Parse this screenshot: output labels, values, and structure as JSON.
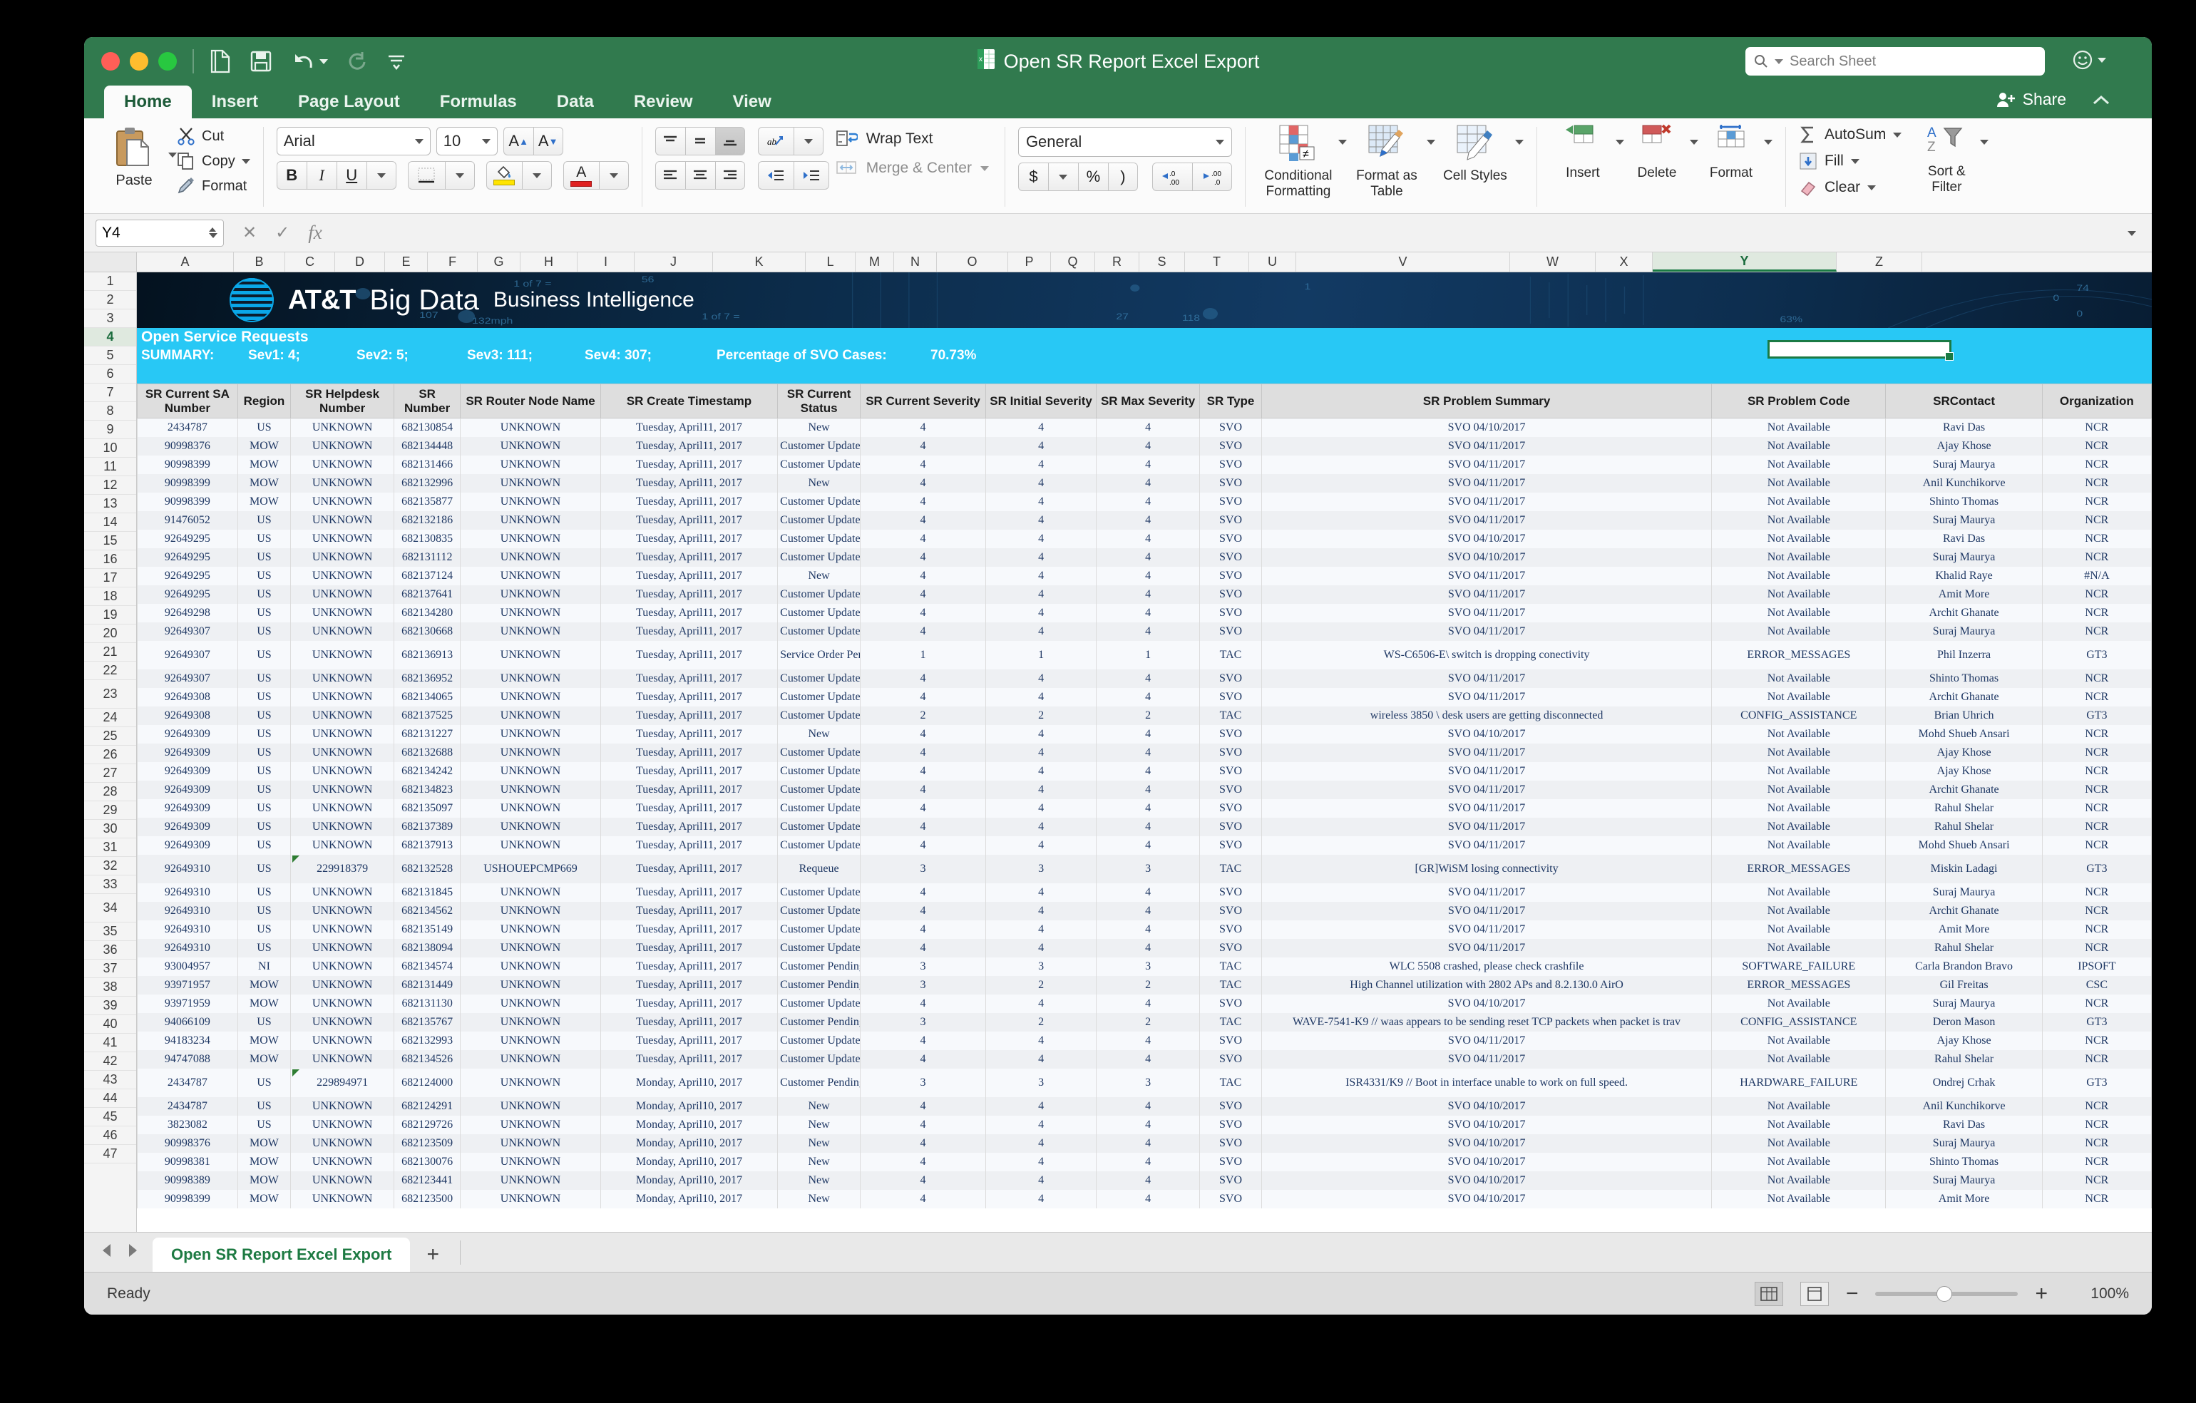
{
  "window": {
    "title": "Open SR Report Excel Export",
    "search_placeholder": "Search Sheet",
    "quick_access": [
      "new-icon",
      "save-icon",
      "undo-icon",
      "redo-icon",
      "customize-icon"
    ]
  },
  "ribbon": {
    "tabs": [
      {
        "label": "Home",
        "active": true
      },
      {
        "label": "Insert",
        "active": false
      },
      {
        "label": "Page Layout",
        "active": false
      },
      {
        "label": "Formulas",
        "active": false
      },
      {
        "label": "Data",
        "active": false
      },
      {
        "label": "Review",
        "active": false
      },
      {
        "label": "View",
        "active": false
      }
    ],
    "share_label": "Share",
    "clipboard": {
      "paste_label": "Paste",
      "cut_label": "Cut",
      "copy_label": "Copy",
      "format_label": "Format"
    },
    "font": {
      "family": "Arial",
      "size": "10",
      "bold": "B",
      "italic": "I",
      "underline": "U",
      "grow_label": "A",
      "shrink_label": "A"
    },
    "alignment": {
      "wrap_text_label": "Wrap Text",
      "merge_center_label": "Merge & Center"
    },
    "number": {
      "format": "General",
      "currency": "$",
      "percent": "%",
      "comma": ")",
      "increase_decimal": ".00",
      "decrease_decimal": ".00"
    },
    "styles": {
      "conditional_formatting": "Conditional Formatting",
      "format_as_table": "Format as Table",
      "cell_styles": "Cell Styles"
    },
    "cells": {
      "insert": "Insert",
      "delete": "Delete",
      "format": "Format"
    },
    "editing": {
      "autosum": "AutoSum",
      "fill": "Fill",
      "clear": "Clear",
      "sort_filter": "Sort & Filter"
    }
  },
  "formula_bar": {
    "name_box": "Y4",
    "formula": ""
  },
  "grid": {
    "columns": [
      "A",
      "B",
      "C",
      "D",
      "E",
      "F",
      "G",
      "H",
      "I",
      "J",
      "K",
      "L",
      "M",
      "N",
      "O",
      "P",
      "Q",
      "R",
      "S",
      "T",
      "U",
      "V",
      "W",
      "X",
      "Y",
      "Z"
    ],
    "selected_column": "Y",
    "selected_cell": "Y4",
    "row_numbers": [
      1,
      2,
      3,
      4,
      5,
      6,
      7,
      8,
      9,
      10,
      11,
      12,
      13,
      14,
      15,
      16,
      17,
      18,
      19,
      20,
      21,
      22,
      23,
      24,
      25,
      26,
      27,
      28,
      29,
      30,
      31,
      32,
      33,
      34,
      35,
      36,
      37,
      38,
      39,
      40,
      41,
      42,
      43,
      44,
      45,
      46,
      47
    ],
    "selected_row": 4
  },
  "banner": {
    "brand": "AT&T",
    "product": "Big Data",
    "subtitle": "Business Intelligence"
  },
  "summary": {
    "title": "Open Service Requests",
    "label": "SUMMARY:",
    "sev1": "Sev1: 4;",
    "sev2": "Sev2: 5;",
    "sev3": "Sev3: 111;",
    "sev4": "Sev4: 307;",
    "pct_label": "Percentage of SVO Cases:",
    "pct_value": "70.73%"
  },
  "table": {
    "headers": [
      "SR Current SA Number",
      "Region",
      "SR Helpdesk Number",
      "SR Number",
      "SR Router Node Name",
      "SR Create Timestamp",
      "SR Current Status",
      "SR Current Severity",
      "SR Initial Severity",
      "SR Max Severity",
      "SR Type",
      "SR Problem Summary",
      "SR Problem Code",
      "SRContact",
      "Organization"
    ],
    "rows": [
      [
        "2434787",
        "US",
        "UNKNOWN",
        "682130854",
        "UNKNOWN",
        "Tuesday, April11, 2017",
        "New",
        "4",
        "4",
        "4",
        "SVO",
        "SVO 04/10/2017",
        "Not Available",
        "Ravi Das",
        "NCR"
      ],
      [
        "90998376",
        "MOW",
        "UNKNOWN",
        "682134448",
        "UNKNOWN",
        "Tuesday, April11, 2017",
        "Customer Updated",
        "4",
        "4",
        "4",
        "SVO",
        "SVO 04/11/2017",
        "Not Available",
        "Ajay Khose",
        "NCR"
      ],
      [
        "90998399",
        "MOW",
        "UNKNOWN",
        "682131466",
        "UNKNOWN",
        "Tuesday, April11, 2017",
        "Customer Updated",
        "4",
        "4",
        "4",
        "SVO",
        "SVO 04/11/2017",
        "Not Available",
        "Suraj Maurya",
        "NCR"
      ],
      [
        "90998399",
        "MOW",
        "UNKNOWN",
        "682132996",
        "UNKNOWN",
        "Tuesday, April11, 2017",
        "New",
        "4",
        "4",
        "4",
        "SVO",
        "SVO 04/11/2017",
        "Not Available",
        "Anil Kunchikorve",
        "NCR"
      ],
      [
        "90998399",
        "MOW",
        "UNKNOWN",
        "682135877",
        "UNKNOWN",
        "Tuesday, April11, 2017",
        "Customer Updated",
        "4",
        "4",
        "4",
        "SVO",
        "SVO 04/11/2017",
        "Not Available",
        "Shinto Thomas",
        "NCR"
      ],
      [
        "91476052",
        "US",
        "UNKNOWN",
        "682132186",
        "UNKNOWN",
        "Tuesday, April11, 2017",
        "Customer Updated",
        "4",
        "4",
        "4",
        "SVO",
        "SVO 04/11/2017",
        "Not Available",
        "Suraj Maurya",
        "NCR"
      ],
      [
        "92649295",
        "US",
        "UNKNOWN",
        "682130835",
        "UNKNOWN",
        "Tuesday, April11, 2017",
        "Customer Updated",
        "4",
        "4",
        "4",
        "SVO",
        "SVO 04/10/2017",
        "Not Available",
        "Ravi Das",
        "NCR"
      ],
      [
        "92649295",
        "US",
        "UNKNOWN",
        "682131112",
        "UNKNOWN",
        "Tuesday, April11, 2017",
        "Customer Updated",
        "4",
        "4",
        "4",
        "SVO",
        "SVO 04/10/2017",
        "Not Available",
        "Suraj Maurya",
        "NCR"
      ],
      [
        "92649295",
        "US",
        "UNKNOWN",
        "682137124",
        "UNKNOWN",
        "Tuesday, April11, 2017",
        "New",
        "4",
        "4",
        "4",
        "SVO",
        "SVO 04/11/2017",
        "Not Available",
        "Khalid Raye",
        "#N/A"
      ],
      [
        "92649295",
        "US",
        "UNKNOWN",
        "682137641",
        "UNKNOWN",
        "Tuesday, April11, 2017",
        "Customer Updated",
        "4",
        "4",
        "4",
        "SVO",
        "SVO 04/11/2017",
        "Not Available",
        "Amit More",
        "NCR"
      ],
      [
        "92649298",
        "US",
        "UNKNOWN",
        "682134280",
        "UNKNOWN",
        "Tuesday, April11, 2017",
        "Customer Updated",
        "4",
        "4",
        "4",
        "SVO",
        "SVO 04/11/2017",
        "Not Available",
        "Archit Ghanate",
        "NCR"
      ],
      [
        "92649307",
        "US",
        "UNKNOWN",
        "682130668",
        "UNKNOWN",
        "Tuesday, April11, 2017",
        "Customer Updated",
        "4",
        "4",
        "4",
        "SVO",
        "SVO 04/11/2017",
        "Not Available",
        "Suraj Maurya",
        "NCR"
      ],
      [
        "92649307",
        "US",
        "UNKNOWN",
        "682136913",
        "UNKNOWN",
        "Tuesday, April11, 2017",
        "Service Order Pending",
        "1",
        "1",
        "1",
        "TAC",
        "WS-C6506-E\\ switch is dropping conectivity",
        "ERROR_MESSAGES",
        "Phil Inzerra",
        "GT3"
      ],
      [
        "92649307",
        "US",
        "UNKNOWN",
        "682136952",
        "UNKNOWN",
        "Tuesday, April11, 2017",
        "Customer Updated",
        "4",
        "4",
        "4",
        "SVO",
        "SVO 04/11/2017",
        "Not Available",
        "Shinto Thomas",
        "NCR"
      ],
      [
        "92649308",
        "US",
        "UNKNOWN",
        "682134065",
        "UNKNOWN",
        "Tuesday, April11, 2017",
        "Customer Updated",
        "4",
        "4",
        "4",
        "SVO",
        "SVO 04/11/2017",
        "Not Available",
        "Archit Ghanate",
        "NCR"
      ],
      [
        "92649308",
        "US",
        "UNKNOWN",
        "682137525",
        "UNKNOWN",
        "Tuesday, April11, 2017",
        "Customer Updated",
        "2",
        "2",
        "2",
        "TAC",
        "wireless 3850 \\ desk users are getting disconnected",
        "CONFIG_ASSISTANCE",
        "Brian Uhrich",
        "GT3"
      ],
      [
        "92649309",
        "US",
        "UNKNOWN",
        "682131227",
        "UNKNOWN",
        "Tuesday, April11, 2017",
        "New",
        "4",
        "4",
        "4",
        "SVO",
        "SVO 04/10/2017",
        "Not Available",
        "Mohd Shueb Ansari",
        "NCR"
      ],
      [
        "92649309",
        "US",
        "UNKNOWN",
        "682132688",
        "UNKNOWN",
        "Tuesday, April11, 2017",
        "Customer Updated",
        "4",
        "4",
        "4",
        "SVO",
        "SVO 04/11/2017",
        "Not Available",
        "Ajay Khose",
        "NCR"
      ],
      [
        "92649309",
        "US",
        "UNKNOWN",
        "682134242",
        "UNKNOWN",
        "Tuesday, April11, 2017",
        "Customer Updated",
        "4",
        "4",
        "4",
        "SVO",
        "SVO 04/11/2017",
        "Not Available",
        "Ajay Khose",
        "NCR"
      ],
      [
        "92649309",
        "US",
        "UNKNOWN",
        "682134823",
        "UNKNOWN",
        "Tuesday, April11, 2017",
        "Customer Updated",
        "4",
        "4",
        "4",
        "SVO",
        "SVO 04/11/2017",
        "Not Available",
        "Archit Ghanate",
        "NCR"
      ],
      [
        "92649309",
        "US",
        "UNKNOWN",
        "682135097",
        "UNKNOWN",
        "Tuesday, April11, 2017",
        "Customer Updated",
        "4",
        "4",
        "4",
        "SVO",
        "SVO 04/11/2017",
        "Not Available",
        "Rahul Shelar",
        "NCR"
      ],
      [
        "92649309",
        "US",
        "UNKNOWN",
        "682137389",
        "UNKNOWN",
        "Tuesday, April11, 2017",
        "Customer Updated",
        "4",
        "4",
        "4",
        "SVO",
        "SVO 04/11/2017",
        "Not Available",
        "Rahul Shelar",
        "NCR"
      ],
      [
        "92649309",
        "US",
        "UNKNOWN",
        "682137913",
        "UNKNOWN",
        "Tuesday, April11, 2017",
        "Customer Updated",
        "4",
        "4",
        "4",
        "SVO",
        "SVO 04/11/2017",
        "Not Available",
        "Mohd Shueb Ansari",
        "NCR"
      ],
      [
        "92649310",
        "US",
        "229918379",
        "682132528",
        "USHOUEPCMP669",
        "Tuesday, April11, 2017",
        "Requeue",
        "3",
        "3",
        "3",
        "TAC",
        "[GR]WiSM losing connectivity",
        "ERROR_MESSAGES",
        "Miskin Ladagi",
        "GT3"
      ],
      [
        "92649310",
        "US",
        "UNKNOWN",
        "682131845",
        "UNKNOWN",
        "Tuesday, April11, 2017",
        "Customer Updated",
        "4",
        "4",
        "4",
        "SVO",
        "SVO 04/11/2017",
        "Not Available",
        "Suraj Maurya",
        "NCR"
      ],
      [
        "92649310",
        "US",
        "UNKNOWN",
        "682134562",
        "UNKNOWN",
        "Tuesday, April11, 2017",
        "Customer Updated",
        "4",
        "4",
        "4",
        "SVO",
        "SVO 04/11/2017",
        "Not Available",
        "Archit Ghanate",
        "NCR"
      ],
      [
        "92649310",
        "US",
        "UNKNOWN",
        "682135149",
        "UNKNOWN",
        "Tuesday, April11, 2017",
        "Customer Updated",
        "4",
        "4",
        "4",
        "SVO",
        "SVO 04/11/2017",
        "Not Available",
        "Amit More",
        "NCR"
      ],
      [
        "92649310",
        "US",
        "UNKNOWN",
        "682138094",
        "UNKNOWN",
        "Tuesday, April11, 2017",
        "Customer Updated",
        "4",
        "4",
        "4",
        "SVO",
        "SVO 04/11/2017",
        "Not Available",
        "Rahul Shelar",
        "NCR"
      ],
      [
        "93004957",
        "NI",
        "UNKNOWN",
        "682134574",
        "UNKNOWN",
        "Tuesday, April11, 2017",
        "Customer Pending",
        "3",
        "3",
        "3",
        "TAC",
        "WLC 5508 crashed, please check crashfile",
        "SOFTWARE_FAILURE",
        "Carla Brandon Bravo",
        "IPSOFT"
      ],
      [
        "93971957",
        "MOW",
        "UNKNOWN",
        "682131449",
        "UNKNOWN",
        "Tuesday, April11, 2017",
        "Customer Pending",
        "3",
        "2",
        "2",
        "TAC",
        "High Channel utilization with 2802 APs and 8.2.130.0 AirO",
        "ERROR_MESSAGES",
        "Gil Freitas",
        "CSC"
      ],
      [
        "93971959",
        "MOW",
        "UNKNOWN",
        "682131130",
        "UNKNOWN",
        "Tuesday, April11, 2017",
        "Customer Updated",
        "4",
        "4",
        "4",
        "SVO",
        "SVO 04/10/2017",
        "Not Available",
        "Suraj Maurya",
        "NCR"
      ],
      [
        "94066109",
        "US",
        "UNKNOWN",
        "682135767",
        "UNKNOWN",
        "Tuesday, April11, 2017",
        "Customer Pending",
        "3",
        "2",
        "2",
        "TAC",
        "WAVE-7541-K9 // waas appears to be sending reset TCP packets when packet is trav",
        "CONFIG_ASSISTANCE",
        "Deron Mason",
        "GT3"
      ],
      [
        "94183234",
        "MOW",
        "UNKNOWN",
        "682132993",
        "UNKNOWN",
        "Tuesday, April11, 2017",
        "Customer Updated",
        "4",
        "4",
        "4",
        "SVO",
        "SVO 04/11/2017",
        "Not Available",
        "Ajay Khose",
        "NCR"
      ],
      [
        "94747088",
        "MOW",
        "UNKNOWN",
        "682134526",
        "UNKNOWN",
        "Tuesday, April11, 2017",
        "Customer Updated",
        "4",
        "4",
        "4",
        "SVO",
        "SVO 04/11/2017",
        "Not Available",
        "Rahul Shelar",
        "NCR"
      ],
      [
        "2434787",
        "US",
        "229894971",
        "682124000",
        "UNKNOWN",
        "Monday, April10, 2017",
        "Customer Pending",
        "3",
        "3",
        "3",
        "TAC",
        "ISR4331/K9 // Boot in interface unable to work on full speed.",
        "HARDWARE_FAILURE",
        "Ondrej Crhak",
        "GT3"
      ],
      [
        "2434787",
        "US",
        "UNKNOWN",
        "682124291",
        "UNKNOWN",
        "Monday, April10, 2017",
        "New",
        "4",
        "4",
        "4",
        "SVO",
        "SVO 04/10/2017",
        "Not Available",
        "Anil Kunchikorve",
        "NCR"
      ],
      [
        "3823082",
        "US",
        "UNKNOWN",
        "682129726",
        "UNKNOWN",
        "Monday, April10, 2017",
        "New",
        "4",
        "4",
        "4",
        "SVO",
        "SVO 04/10/2017",
        "Not Available",
        "Ravi Das",
        "NCR"
      ],
      [
        "90998376",
        "MOW",
        "UNKNOWN",
        "682123509",
        "UNKNOWN",
        "Monday, April10, 2017",
        "New",
        "4",
        "4",
        "4",
        "SVO",
        "SVO 04/10/2017",
        "Not Available",
        "Suraj Maurya",
        "NCR"
      ],
      [
        "90998381",
        "MOW",
        "UNKNOWN",
        "682130076",
        "UNKNOWN",
        "Monday, April10, 2017",
        "New",
        "4",
        "4",
        "4",
        "SVO",
        "SVO 04/10/2017",
        "Not Available",
        "Shinto Thomas",
        "NCR"
      ],
      [
        "90998389",
        "MOW",
        "UNKNOWN",
        "682123441",
        "UNKNOWN",
        "Monday, April10, 2017",
        "New",
        "4",
        "4",
        "4",
        "SVO",
        "SVO 04/10/2017",
        "Not Available",
        "Suraj Maurya",
        "NCR"
      ],
      [
        "90998399",
        "MOW",
        "UNKNOWN",
        "682123500",
        "UNKNOWN",
        "Monday, April10, 2017",
        "New",
        "4",
        "4",
        "4",
        "SVO",
        "SVO 04/10/2017",
        "Not Available",
        "Amit More",
        "NCR"
      ]
    ],
    "comment_rows": [
      12,
      23,
      34
    ]
  },
  "sheet_tabs": {
    "tabs": [
      {
        "label": "Open SR Report Excel Export",
        "active": true
      }
    ],
    "add_label": "+"
  },
  "status": {
    "message": "Ready",
    "zoom": "100%"
  }
}
